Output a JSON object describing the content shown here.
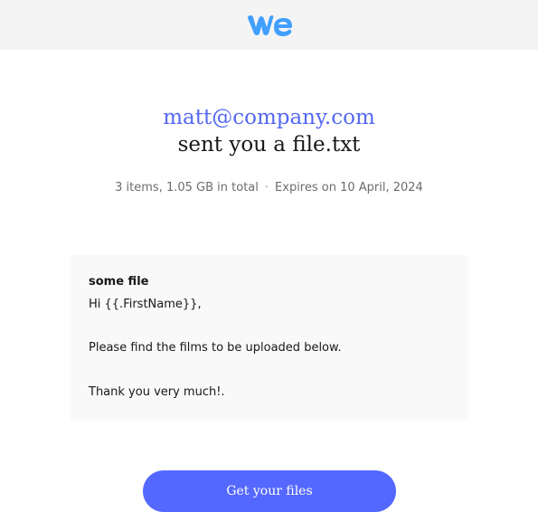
{
  "header": {
    "logo_icon": "wetransfer-logo-icon",
    "brand_color": "#409fff"
  },
  "transfer": {
    "sender_email": "matt@company.com",
    "subject": "sent you a file.txt",
    "items_info": "3 items, 1.05 GB in total",
    "separator": "·",
    "expiry": "Expires on 10 April, 2024"
  },
  "message": {
    "title": "some file",
    "lines": [
      "Hi {{.FirstName}},",
      "Please find the films to be uploaded below.",
      "Thank you very much!."
    ]
  },
  "cta": {
    "label": "Get your files",
    "color": "#5468ff"
  }
}
